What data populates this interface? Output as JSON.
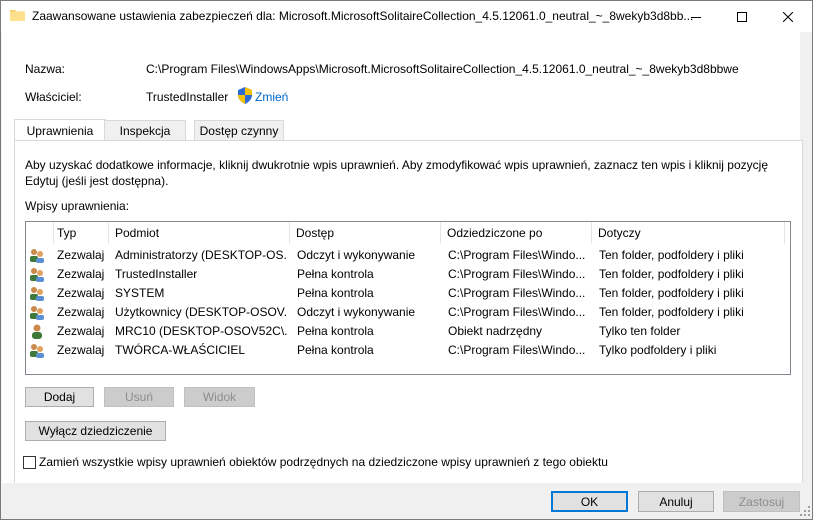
{
  "window": {
    "title": "Zaawansowane ustawienia zabezpieczeń dla: Microsoft.MicrosoftSolitaireCollection_4.5.12061.0_neutral_~_8wekyb3d8bb..."
  },
  "header": {
    "name_label": "Nazwa:",
    "name_value": "C:\\Program Files\\WindowsApps\\Microsoft.MicrosoftSolitaireCollection_4.5.12061.0_neutral_~_8wekyb3d8bbwe",
    "owner_label": "Właściciel:",
    "owner_value": "TrustedInstaller",
    "change_link": "Zmień"
  },
  "tabs": [
    {
      "label": "Uprawnienia",
      "active": true
    },
    {
      "label": "Inspekcja",
      "active": false
    },
    {
      "label": "Dostęp czynny",
      "active": false
    }
  ],
  "permissions": {
    "info_text_line1": "Aby uzyskać dodatkowe informacje, kliknij dwukrotnie wpis uprawnień. Aby zmodyfikować wpis uprawnień, zaznacz ten wpis i kliknij pozycję",
    "info_text_line2": "Edytuj (jeśli jest dostępna).",
    "entries_label": "Wpisy uprawnienia:",
    "columns": [
      "Typ",
      "Podmiot",
      "Dostęp",
      "Odziedziczone po",
      "Dotyczy"
    ],
    "rows": [
      {
        "icon": "group-icon",
        "type": "Zezwalaj",
        "principal": "Administratorzy (DESKTOP-OS...",
        "access": "Odczyt i wykonywanie",
        "inherited": "C:\\Program Files\\Windo...",
        "applies": "Ten folder, podfoldery i pliki"
      },
      {
        "icon": "group-icon",
        "type": "Zezwalaj",
        "principal": "TrustedInstaller",
        "access": "Pełna kontrola",
        "inherited": "C:\\Program Files\\Windo...",
        "applies": "Ten folder, podfoldery i pliki"
      },
      {
        "icon": "group-icon",
        "type": "Zezwalaj",
        "principal": "SYSTEM",
        "access": "Pełna kontrola",
        "inherited": "C:\\Program Files\\Windo...",
        "applies": "Ten folder, podfoldery i pliki"
      },
      {
        "icon": "group-icon",
        "type": "Zezwalaj",
        "principal": "Użytkownicy (DESKTOP-OSOV...",
        "access": "Odczyt i wykonywanie",
        "inherited": "C:\\Program Files\\Windo...",
        "applies": "Ten folder, podfoldery i pliki"
      },
      {
        "icon": "user-icon",
        "type": "Zezwalaj",
        "principal": "MRC10 (DESKTOP-OSOV52C\\...",
        "access": "Pełna kontrola",
        "inherited": "Obiekt nadrzędny",
        "applies": "Tylko ten folder"
      },
      {
        "icon": "group-icon",
        "type": "Zezwalaj",
        "principal": "TWÓRCA-WŁAŚCICIEL",
        "access": "Pełna kontrola",
        "inherited": "C:\\Program Files\\Windo...",
        "applies": "Tylko podfoldery i pliki"
      }
    ],
    "add_button": "Dodaj",
    "remove_button": "Usuń",
    "view_button": "Widok",
    "disable_inheritance_button": "Wyłącz dziedziczenie",
    "replace_checkbox_label": "Zamień wszystkie wpisy uprawnień obiektów podrzędnych na dziedziczone wpisy uprawnień z tego obiektu"
  },
  "footer": {
    "ok": "OK",
    "cancel": "Anuluj",
    "apply": "Zastosuj"
  }
}
